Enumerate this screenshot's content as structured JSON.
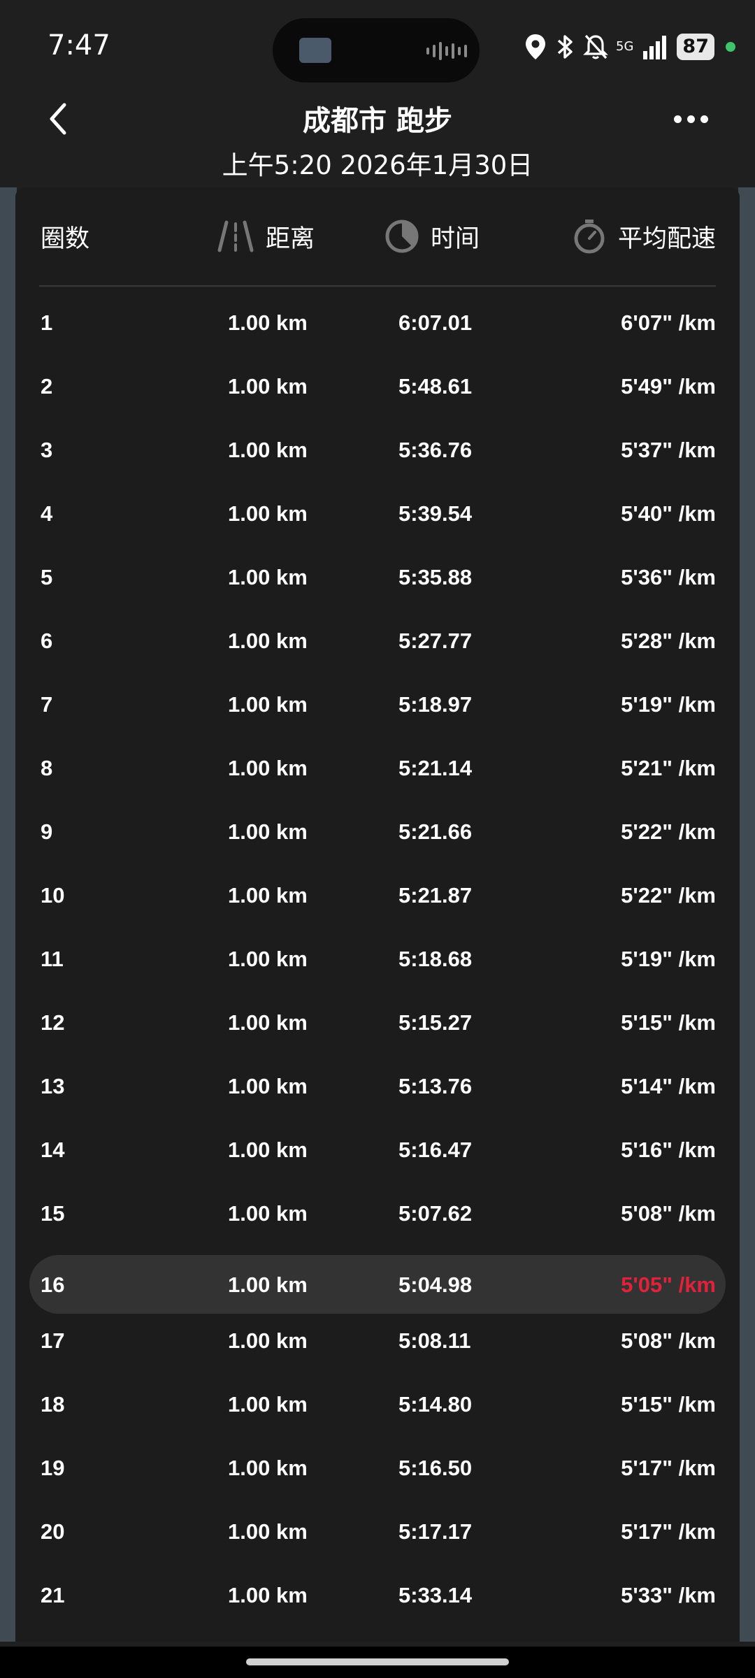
{
  "status_bar": {
    "time": "7:47",
    "network": "5G",
    "battery": "87"
  },
  "header": {
    "title": "成都市 跑步",
    "subtitle": "上午5:20 2026年1月30日"
  },
  "table": {
    "headers": {
      "lap": "圈数",
      "distance": "距离",
      "time": "时间",
      "pace": "平均配速"
    },
    "highlight_color": "#e0223a",
    "rows": [
      {
        "lap": "1",
        "distance": "1.00 km",
        "time": "6:07.01",
        "pace": "6'07\" /km"
      },
      {
        "lap": "2",
        "distance": "1.00 km",
        "time": "5:48.61",
        "pace": "5'49\" /km"
      },
      {
        "lap": "3",
        "distance": "1.00 km",
        "time": "5:36.76",
        "pace": "5'37\" /km"
      },
      {
        "lap": "4",
        "distance": "1.00 km",
        "time": "5:39.54",
        "pace": "5'40\" /km"
      },
      {
        "lap": "5",
        "distance": "1.00 km",
        "time": "5:35.88",
        "pace": "5'36\" /km"
      },
      {
        "lap": "6",
        "distance": "1.00 km",
        "time": "5:27.77",
        "pace": "5'28\" /km"
      },
      {
        "lap": "7",
        "distance": "1.00 km",
        "time": "5:18.97",
        "pace": "5'19\" /km"
      },
      {
        "lap": "8",
        "distance": "1.00 km",
        "time": "5:21.14",
        "pace": "5'21\" /km"
      },
      {
        "lap": "9",
        "distance": "1.00 km",
        "time": "5:21.66",
        "pace": "5'22\" /km"
      },
      {
        "lap": "10",
        "distance": "1.00 km",
        "time": "5:21.87",
        "pace": "5'22\" /km"
      },
      {
        "lap": "11",
        "distance": "1.00 km",
        "time": "5:18.68",
        "pace": "5'19\" /km"
      },
      {
        "lap": "12",
        "distance": "1.00 km",
        "time": "5:15.27",
        "pace": "5'15\" /km"
      },
      {
        "lap": "13",
        "distance": "1.00 km",
        "time": "5:13.76",
        "pace": "5'14\" /km"
      },
      {
        "lap": "14",
        "distance": "1.00 km",
        "time": "5:16.47",
        "pace": "5'16\" /km"
      },
      {
        "lap": "15",
        "distance": "1.00 km",
        "time": "5:07.62",
        "pace": "5'08\" /km"
      },
      {
        "lap": "16",
        "distance": "1.00 km",
        "time": "5:04.98",
        "pace": "5'05\" /km"
      },
      {
        "lap": "17",
        "distance": "1.00 km",
        "time": "5:08.11",
        "pace": "5'08\" /km"
      },
      {
        "lap": "18",
        "distance": "1.00 km",
        "time": "5:14.80",
        "pace": "5'15\" /km"
      },
      {
        "lap": "19",
        "distance": "1.00 km",
        "time": "5:16.50",
        "pace": "5'17\" /km"
      },
      {
        "lap": "20",
        "distance": "1.00 km",
        "time": "5:17.17",
        "pace": "5'17\" /km"
      },
      {
        "lap": "21",
        "distance": "1.00 km",
        "time": "5:33.14",
        "pace": "5'33\" /km"
      }
    ],
    "fastest_lap": "16"
  }
}
